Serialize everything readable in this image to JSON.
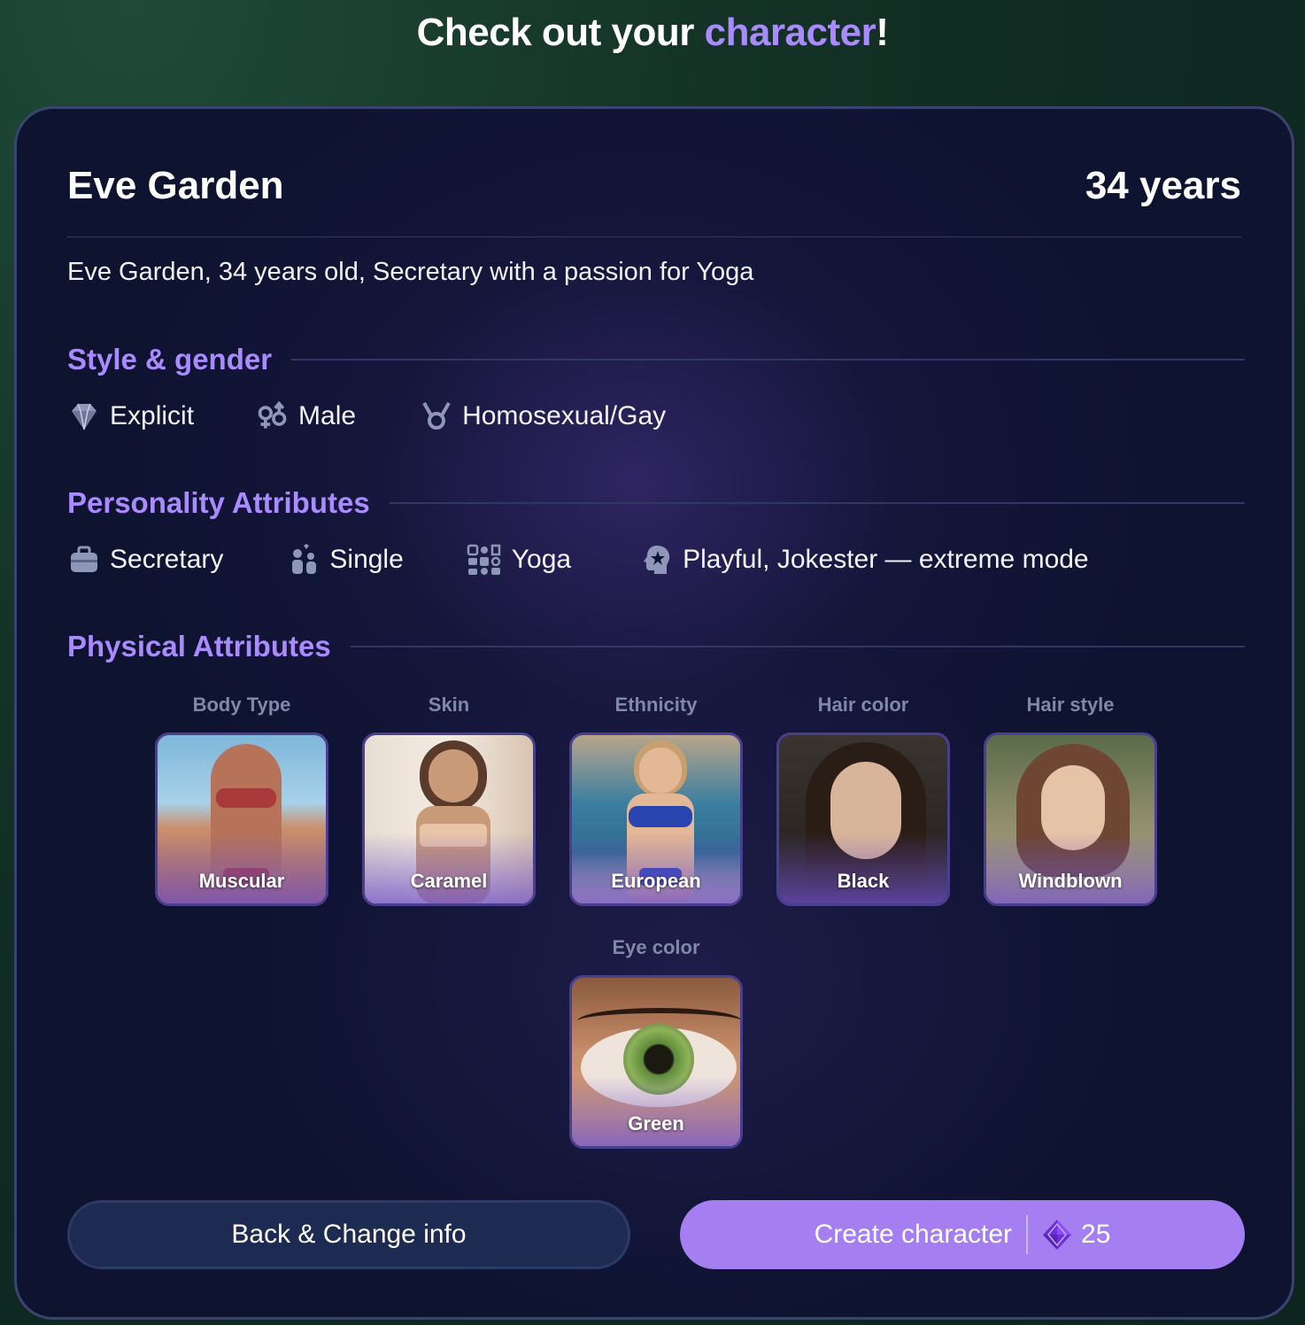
{
  "headline": {
    "prefix": "Check out your ",
    "accent": "character",
    "suffix": "!"
  },
  "character": {
    "name": "Eve Garden",
    "age": "34 years",
    "summary": "Eve Garden, 34 years old, Secretary with a passion for Yoga"
  },
  "style_gender": {
    "title": "Style & gender",
    "items": [
      {
        "icon": "diamond-icon",
        "label": "Explicit"
      },
      {
        "icon": "gender-symbols-icon",
        "label": "Male"
      },
      {
        "icon": "orientation-icon",
        "label": "Homosexual/Gay"
      }
    ]
  },
  "personality": {
    "title": "Personality Attributes",
    "items": [
      {
        "icon": "briefcase-icon",
        "label": "Secretary"
      },
      {
        "icon": "single-person-icon",
        "label": "Single"
      },
      {
        "icon": "hobby-grid-icon",
        "label": "Yoga"
      },
      {
        "icon": "personality-head-icon",
        "label": "Playful, Jokester — extreme mode"
      }
    ]
  },
  "physical": {
    "title": "Physical Attributes",
    "attributes": [
      {
        "label": "Body Type",
        "value": "Muscular"
      },
      {
        "label": "Skin",
        "value": "Caramel"
      },
      {
        "label": "Ethnicity",
        "value": "European"
      },
      {
        "label": "Hair color",
        "value": "Black"
      },
      {
        "label": "Hair style",
        "value": "Windblown"
      },
      {
        "label": "Eye color",
        "value": "Green"
      }
    ]
  },
  "actions": {
    "back_label": "Back & Change info",
    "create_label": "Create character",
    "create_cost": "25"
  },
  "colors": {
    "accent": "#a98bff",
    "button_primary": "#a57ff2",
    "card_bg": "#0e1330"
  }
}
